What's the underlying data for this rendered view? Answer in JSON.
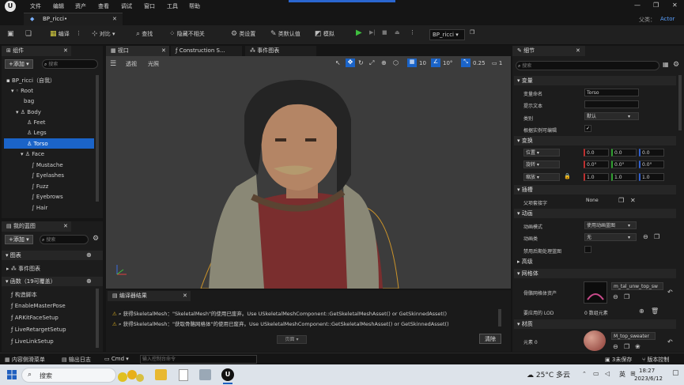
{
  "menu": {
    "items": [
      "文件",
      "编辑",
      "资产",
      "查看",
      "调试",
      "窗口",
      "工具",
      "帮助"
    ]
  },
  "title": {
    "parent_label": "父类：",
    "parent_value": "Actor"
  },
  "tab": {
    "label": "BP_ricci•"
  },
  "toolbar": {
    "compile": "编译",
    "diff": "对比",
    "find": "查找",
    "hide_unrelated": "隐藏不相关",
    "class_settings": "类设置",
    "class_defaults": "类默认值",
    "simulate": "模拟",
    "debug_object": "BP_ricci"
  },
  "components": {
    "title": "组件",
    "add": "+添加",
    "search_placeholder": "搜索",
    "items": [
      "BP_ricci（自我）",
      "Root",
      "bag",
      "Body",
      "Feet",
      "Legs",
      "Torso",
      "Face",
      "Mustache",
      "Eyelashes",
      "Fuzz",
      "Eyebrows",
      "Hair"
    ]
  },
  "viewport_tabs": [
    "视口",
    "Construction S...",
    "事件图表"
  ],
  "viewport": {
    "perspective": "透视",
    "lit": "光照",
    "grid": "10",
    "angle": "10°",
    "scale": "0.25",
    "cam": "1"
  },
  "mybp": {
    "title": "我的蓝图",
    "add": "+添加",
    "search_placeholder": "搜索",
    "graphs": "图表",
    "event_graph": "事件图表",
    "functions": "函数（19可覆盖）",
    "function_items": [
      "构造脚本",
      "EnableMasterPose",
      "ARKitFaceSetup",
      "LiveRetargetSetup",
      "LiveLinkSetup"
    ]
  },
  "compiler": {
    "title": "编译器结果",
    "msg1": "获得SkeletalMesh：\"SkeletalMesh\"的使用已废弃。Use USkeletalMeshComponent::GetSkeletalMeshAsset() or GetSkinnedAsset()",
    "msg2": "获得SkeletalMesh：\"获取骨骼网格体\"的使用已废弃。Use USkeletalMeshComponent::GetSkeletalMeshAsset() or GetSkinnedAsset()",
    "page": "页面",
    "clear": "清除"
  },
  "details": {
    "title": "细节",
    "search_placeholder": "搜索",
    "variable": "变量",
    "var_name_label": "变量命名",
    "var_name": "Torso",
    "tooltip_label": "提示文本",
    "category_label": "类别",
    "category": "默认",
    "editable_label": "根据实例可编辑",
    "transform": "变换",
    "location": "位置",
    "rotation": "旋转",
    "scale": "缩放",
    "loc": [
      "0.0",
      "0.0",
      "0.0"
    ],
    "rot": [
      "0.0°",
      "0.0°",
      "0.0°"
    ],
    "scl": [
      "1.0",
      "1.0",
      "1.0"
    ],
    "sockets": "插槽",
    "parent_socket_label": "父项套接字",
    "parent_socket": "None",
    "animation": "动画",
    "anim_mode_label": "动画模式",
    "anim_mode": "使用动画蓝图",
    "anim_class_label": "动画类",
    "anim_class": "无",
    "disable_post": "禁用后期处理蓝图",
    "advanced": "高级",
    "mesh": "网格体",
    "skel_mesh_label": "骨骼网格体资产",
    "skel_mesh": "m_tal_unw_top_sw",
    "lod_label": "要应用的 LOD",
    "lod_value": "0 数组元素",
    "materials": "材质",
    "elem0": "元素 0",
    "mat": "M_top_sweater"
  },
  "statusbar": {
    "content": "内容侧滑菜单",
    "output": "输出日志",
    "cmd": "Cmd",
    "console_placeholder": "输入控制台命令",
    "unsaved": "3未保存",
    "source": "版本控制"
  },
  "taskbar": {
    "search": "搜索",
    "weather": "25°C 多云",
    "lang": "英",
    "time": "18:27",
    "date": "2023/6/12"
  }
}
